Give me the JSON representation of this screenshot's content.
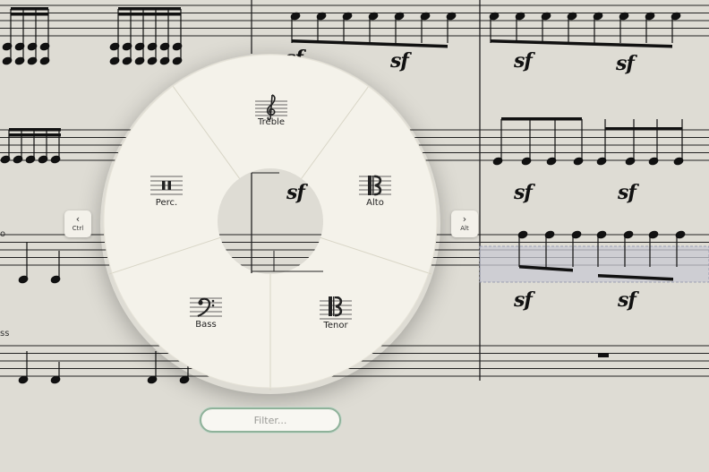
{
  "wheel": {
    "items": [
      {
        "label": "Treble",
        "icon": "treble-clef-icon"
      },
      {
        "label": "Alto",
        "icon": "alto-clef-icon"
      },
      {
        "label": "Tenor",
        "icon": "tenor-clef-icon"
      },
      {
        "label": "Bass",
        "icon": "bass-clef-icon"
      },
      {
        "label": "Perc.",
        "icon": "percussion-clef-icon"
      }
    ]
  },
  "nav": {
    "prev_key": "Ctrl",
    "next_key": "Alt",
    "prev_arrow": "‹",
    "next_arrow": "›"
  },
  "filter": {
    "placeholder": "Filter..."
  },
  "score": {
    "dynamics": [
      "sf",
      "sf",
      "sf",
      "sf",
      "sf",
      "sf",
      "sf",
      "sf",
      "sf"
    ],
    "labels": [
      "o",
      "ss"
    ]
  },
  "colors": {
    "paper": "#dedcd4",
    "wheel": "#f4f2ea",
    "selection": "#c8cad3",
    "filter_border": "#8fb29a"
  }
}
